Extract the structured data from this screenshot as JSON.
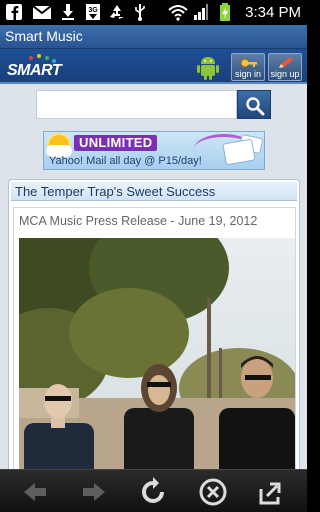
{
  "status_bar": {
    "time": "3:34 PM",
    "icons": [
      "facebook-icon",
      "gmail-icon",
      "download-icon",
      "3g-icon",
      "recycle-icon",
      "usb-icon",
      "wifi-icon",
      "signal-icon",
      "battery-charging-icon"
    ]
  },
  "app": {
    "title": "Smart Music"
  },
  "header": {
    "logo_text": "SMART",
    "android_icon": "android-icon",
    "sign_in_label": "sign in",
    "sign_up_label": "sign up"
  },
  "search": {
    "value": "",
    "placeholder": "",
    "icon": "search-icon"
  },
  "banner": {
    "headline": "UNLIMITED",
    "subtext": "Yahoo! Mail all day @ P15/day!"
  },
  "article": {
    "title": "The Temper Trap's Sweet Success",
    "press_line": "MCA Music Press Release - June 19, 2012",
    "photo": "band-photo"
  },
  "bottom_bar": {
    "icons": [
      "back-arrow-icon",
      "forward-arrow-icon",
      "refresh-icon",
      "stop-icon",
      "share-icon"
    ]
  },
  "colors": {
    "title_bar": "#2f5c9b",
    "header": "#1f4f96",
    "page_bg": "#dde3ea",
    "banner_purple": "#7b2fb5"
  }
}
